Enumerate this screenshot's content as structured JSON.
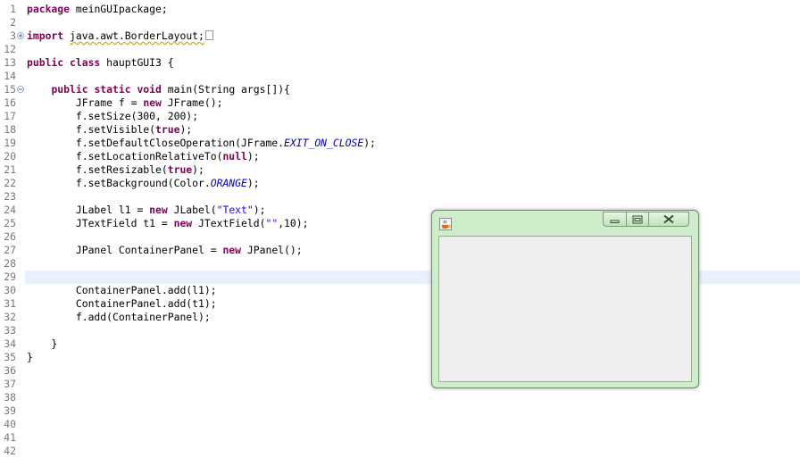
{
  "editor": {
    "lines": [
      {
        "n": "1",
        "fold": "",
        "collapsed": false,
        "tokens": [
          [
            "kw",
            "package"
          ],
          [
            "",
            "meinGUIpackage;"
          ]
        ]
      },
      {
        "n": "2",
        "fold": "",
        "collapsed": false,
        "tokens": []
      },
      {
        "n": "3",
        "fold": "plus",
        "collapsed": true,
        "tokens": [
          [
            "kw",
            "import"
          ],
          [
            "warn",
            "java.awt.BorderLayout;"
          ]
        ]
      },
      {
        "n": "12",
        "fold": "",
        "collapsed": false,
        "tokens": []
      },
      {
        "n": "13",
        "fold": "",
        "collapsed": false,
        "tokens": [
          [
            "kw",
            "public class"
          ],
          [
            "",
            " hauptGUI3 {"
          ]
        ]
      },
      {
        "n": "14",
        "fold": "",
        "collapsed": false,
        "tokens": []
      },
      {
        "n": "15",
        "fold": "minus",
        "collapsed": false,
        "tokens": [
          [
            "",
            "    "
          ],
          [
            "kw",
            "public static void"
          ],
          [
            "",
            " main(String "
          ],
          [
            "",
            "args"
          ],
          [
            "",
            "[]){"
          ]
        ]
      },
      {
        "n": "16",
        "fold": "",
        "collapsed": false,
        "tokens": [
          [
            "",
            "        JFrame "
          ],
          [
            "",
            "f"
          ],
          [
            "",
            " = "
          ],
          [
            "kw",
            "new"
          ],
          [
            "",
            " JFrame();"
          ]
        ]
      },
      {
        "n": "17",
        "fold": "",
        "collapsed": false,
        "tokens": [
          [
            "",
            "        f.setSize(300, 200);"
          ]
        ]
      },
      {
        "n": "18",
        "fold": "",
        "collapsed": false,
        "tokens": [
          [
            "",
            "        f.setVisible("
          ],
          [
            "kw",
            "true"
          ],
          [
            "",
            ");"
          ]
        ]
      },
      {
        "n": "19",
        "fold": "",
        "collapsed": false,
        "tokens": [
          [
            "",
            "        f.setDefaultCloseOperation(JFrame."
          ],
          [
            "sfield",
            "EXIT_ON_CLOSE"
          ],
          [
            "",
            ");"
          ]
        ]
      },
      {
        "n": "20",
        "fold": "",
        "collapsed": false,
        "tokens": [
          [
            "",
            "        f.setLocationRelativeTo("
          ],
          [
            "kw",
            "null"
          ],
          [
            "",
            ");"
          ]
        ]
      },
      {
        "n": "21",
        "fold": "",
        "collapsed": false,
        "tokens": [
          [
            "",
            "        f.setResizable("
          ],
          [
            "kw",
            "true"
          ],
          [
            "",
            ");"
          ]
        ]
      },
      {
        "n": "22",
        "fold": "",
        "collapsed": false,
        "tokens": [
          [
            "",
            "        f.setBackground(Color."
          ],
          [
            "sfield",
            "ORANGE"
          ],
          [
            "",
            ");"
          ]
        ]
      },
      {
        "n": "23",
        "fold": "",
        "collapsed": false,
        "tokens": []
      },
      {
        "n": "24",
        "fold": "",
        "collapsed": false,
        "tokens": [
          [
            "",
            "        JLabel l1 = "
          ],
          [
            "kw",
            "new"
          ],
          [
            "",
            " JLabel("
          ],
          [
            "str",
            "\"Text\""
          ],
          [
            "",
            ");"
          ]
        ]
      },
      {
        "n": "25",
        "fold": "",
        "collapsed": false,
        "tokens": [
          [
            "",
            "        JTextField t1 = "
          ],
          [
            "kw",
            "new"
          ],
          [
            "",
            " JTextField("
          ],
          [
            "str",
            "\"\""
          ],
          [
            "",
            ",10);"
          ]
        ]
      },
      {
        "n": "26",
        "fold": "",
        "collapsed": false,
        "tokens": []
      },
      {
        "n": "27",
        "fold": "",
        "collapsed": false,
        "tokens": [
          [
            "",
            "        JPanel ContainerPanel = "
          ],
          [
            "kw",
            "new"
          ],
          [
            "",
            " JPanel();"
          ]
        ]
      },
      {
        "n": "28",
        "fold": "",
        "collapsed": false,
        "tokens": []
      },
      {
        "n": "29",
        "fold": "",
        "collapsed": false,
        "tokens": []
      },
      {
        "n": "30",
        "fold": "",
        "collapsed": false,
        "tokens": [
          [
            "",
            "        ContainerPanel.add(l1);"
          ]
        ]
      },
      {
        "n": "31",
        "fold": "",
        "collapsed": false,
        "tokens": [
          [
            "",
            "        ContainerPanel.add(t1);"
          ]
        ]
      },
      {
        "n": "32",
        "fold": "",
        "collapsed": false,
        "tokens": [
          [
            "",
            "        f.add(ContainerPanel);"
          ]
        ]
      },
      {
        "n": "33",
        "fold": "",
        "collapsed": false,
        "tokens": []
      },
      {
        "n": "34",
        "fold": "",
        "collapsed": false,
        "tokens": [
          [
            "",
            "    }"
          ]
        ]
      },
      {
        "n": "35",
        "fold": "",
        "collapsed": false,
        "tokens": [
          [
            "",
            "}"
          ]
        ]
      },
      {
        "n": "36",
        "fold": "",
        "collapsed": false,
        "tokens": []
      },
      {
        "n": "37",
        "fold": "",
        "collapsed": false,
        "tokens": []
      },
      {
        "n": "38",
        "fold": "",
        "collapsed": false,
        "tokens": []
      },
      {
        "n": "39",
        "fold": "",
        "collapsed": false,
        "tokens": []
      },
      {
        "n": "40",
        "fold": "",
        "collapsed": false,
        "tokens": []
      },
      {
        "n": "41",
        "fold": "",
        "collapsed": false,
        "tokens": []
      },
      {
        "n": "42",
        "fold": "",
        "collapsed": false,
        "tokens": []
      }
    ],
    "current_line": "29"
  },
  "java_window": {
    "title_icon": "java-cup-icon",
    "controls": [
      {
        "name": "minimize-button",
        "icon": "minimize-icon"
      },
      {
        "name": "maximize-button",
        "icon": "maximize-icon"
      },
      {
        "name": "close-button",
        "icon": "close-icon"
      }
    ]
  },
  "colors": {
    "keyword": "#7f0055",
    "string": "#2a00ff",
    "static_field": "#0000c0",
    "line_number": "#787878",
    "current_line_highlight": "#e8f2fe",
    "window_frame": "#cdeec8",
    "window_client": "#eeeeee"
  }
}
